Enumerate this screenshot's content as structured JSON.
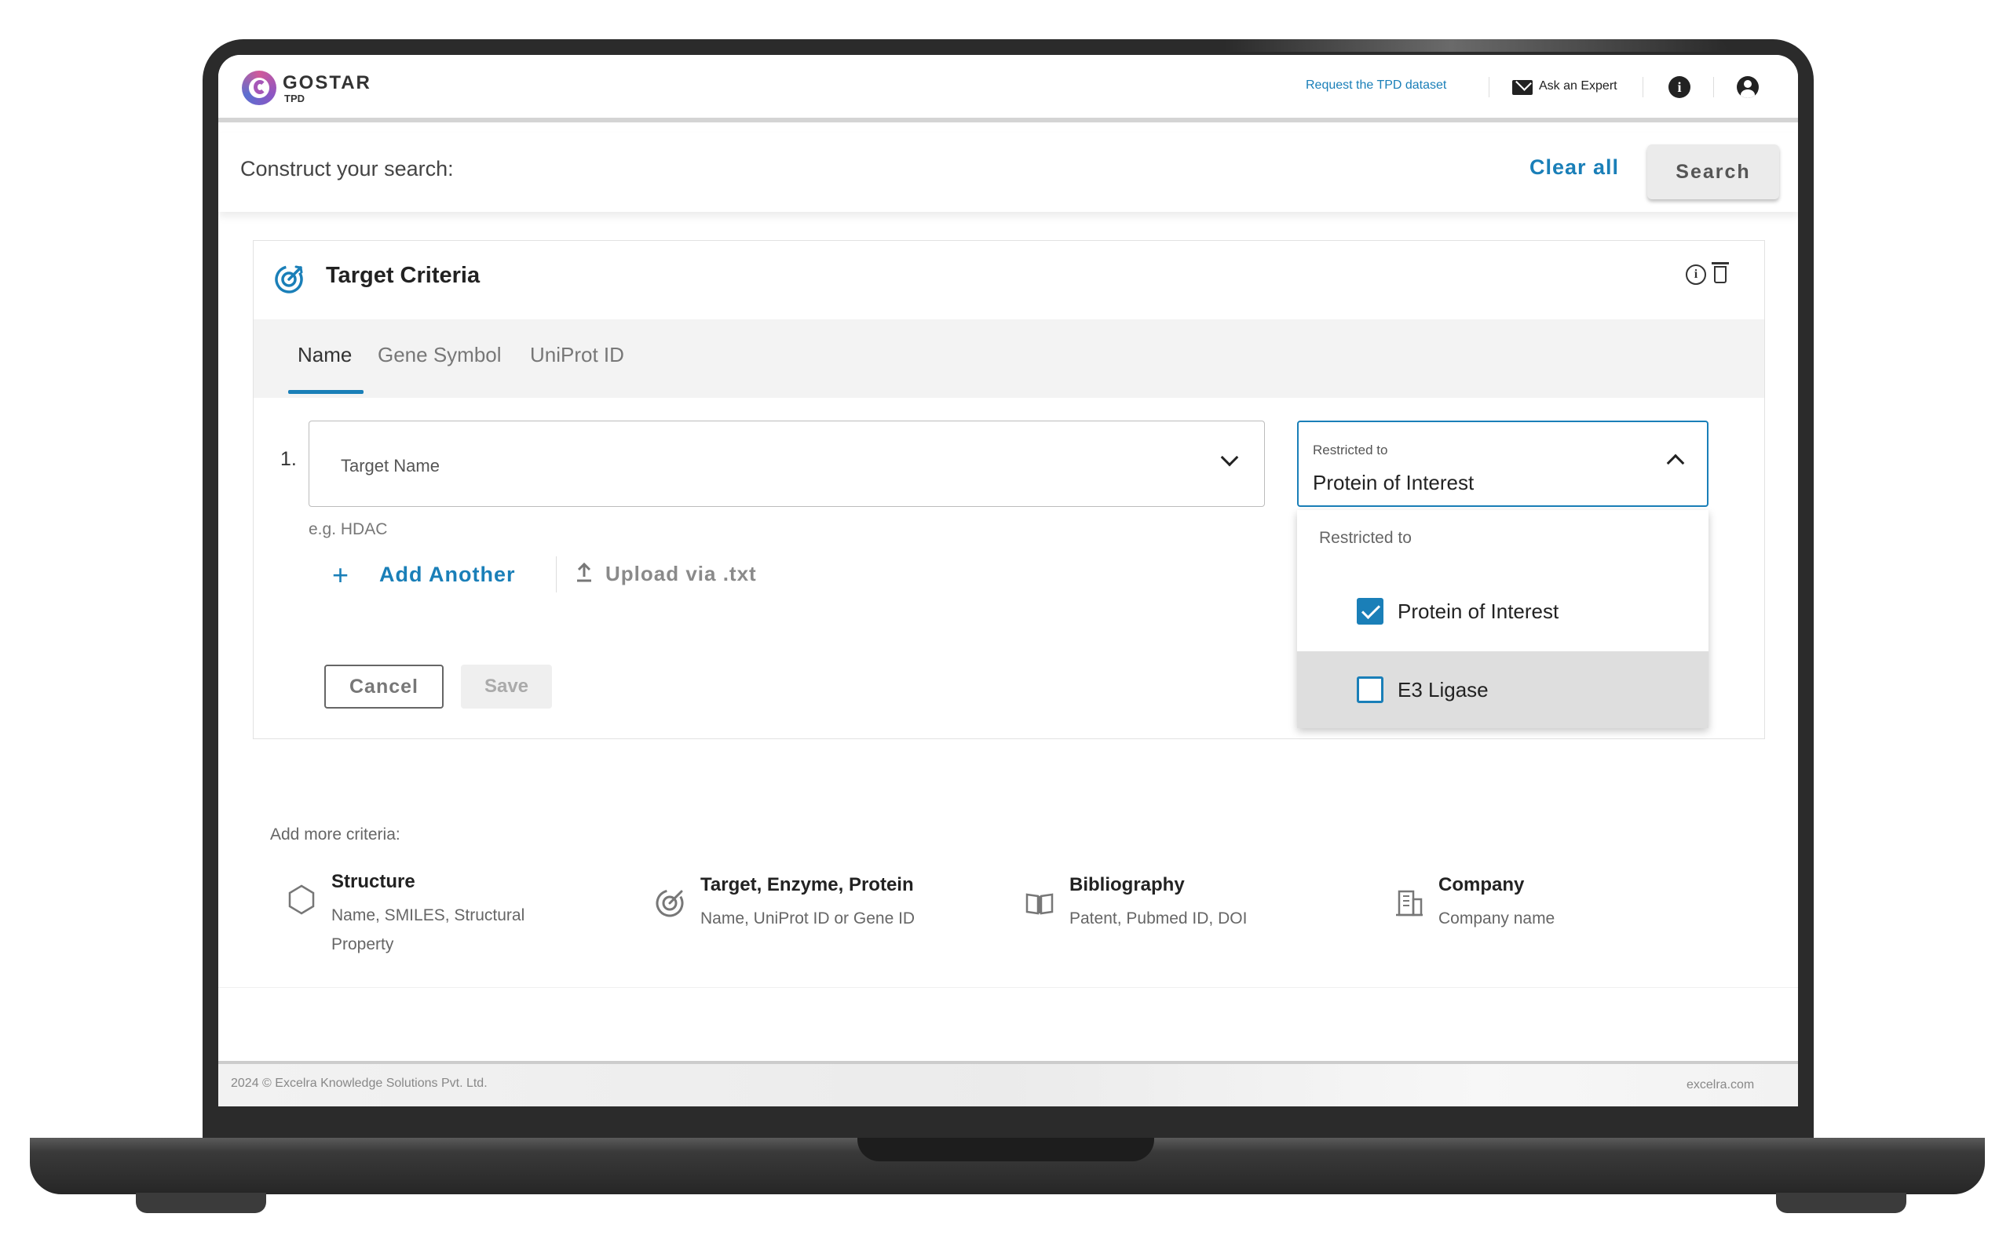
{
  "brand": {
    "name": "GOSTAR",
    "sub": "TPD"
  },
  "header": {
    "request_link": "Request the TPD dataset",
    "ask_expert": "Ask an Expert"
  },
  "construct": {
    "label": "Construct your search:",
    "clear_all": "Clear all",
    "search": "Search"
  },
  "criteria": {
    "title": "Target Criteria",
    "tabs": [
      "Name",
      "Gene Symbol",
      "UniProt ID"
    ],
    "active_tab": "Name",
    "row_number": "1.",
    "name_placeholder": "Target Name",
    "hint": "e.g. HDAC",
    "add_another": "Add Another",
    "upload": "Upload via .txt",
    "cancel": "Cancel",
    "save": "Save"
  },
  "restricted": {
    "label": "Restricted to",
    "value": "Protein of Interest",
    "menu_header": "Restricted to",
    "options": [
      {
        "label": "Protein of Interest",
        "checked": true
      },
      {
        "label": "E3 Ligase",
        "checked": false
      }
    ]
  },
  "more": {
    "label": "Add more criteria:",
    "items": [
      {
        "title": "Structure",
        "subtitle": "Name, SMILES, Structural Property",
        "icon": "hexagon-icon"
      },
      {
        "title": "Target, Enzyme, Protein",
        "subtitle": "Name, UniProt ID or Gene ID",
        "icon": "target-icon"
      },
      {
        "title": "Bibliography",
        "subtitle": "Patent, Pubmed ID, DOI",
        "icon": "book-icon"
      },
      {
        "title": "Company",
        "subtitle": "Company name",
        "icon": "building-icon"
      }
    ]
  },
  "footer": {
    "copyright": "2024 © Excelra Knowledge Solutions Pvt. Ltd.",
    "site": "excelra.com"
  },
  "colors": {
    "accent": "#1a7fb8",
    "frame": "#2b2b2b"
  }
}
